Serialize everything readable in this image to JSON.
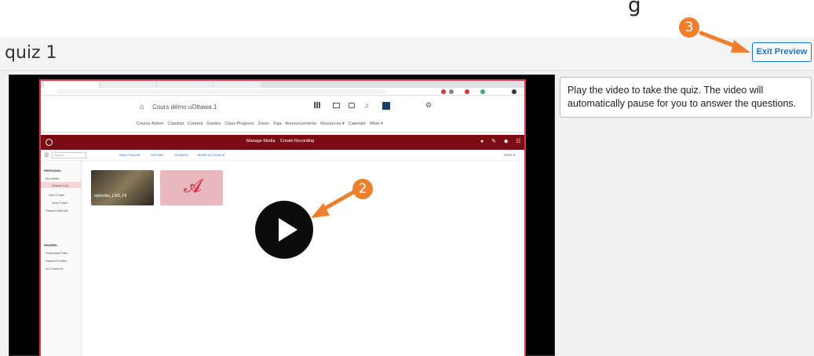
{
  "header": {
    "title": "quiz 1",
    "top_partial_text": "g"
  },
  "actions": {
    "exit_preview_label": "Exit Preview"
  },
  "instructions": {
    "text": "Play the video to take the quiz. The video will automatically pause for you to answer the questions."
  },
  "annotations": {
    "step2_label": "2",
    "step3_label": "3",
    "accent_color": "#ee7f2d"
  },
  "video_screen": {
    "course_title": "Cours démo uOttawa 1",
    "nav_items": [
      "Course Admin",
      "Classlist",
      "Content",
      "Grades",
      "Class Progress",
      "Zoom",
      "Yuja",
      "Announcements",
      "Resources ▾",
      "Calendar",
      "More ▾"
    ],
    "yuja_center_buttons": [
      "Manage Media",
      "Create Recording"
    ],
    "toolbar_items": [
      "NEW FOLDER",
      "UPLOAD",
      "GO BACK",
      "MORE ACTIONS ▾"
    ],
    "search_placeholder": "Search",
    "sort_label": "SORT ▾",
    "sidebar_personal_header": "PERSONAL",
    "sidebar_personal_items": [
      "My Media",
      "Default Coll...",
      "New Folder",
      "New Folder",
      "Shared With Me"
    ],
    "sidebar_shared_header": "SHARED",
    "sidebar_shared_items": [
      "Enterprise/Tube",
      "Shared Folders",
      "All Channels"
    ],
    "thumb1_label": "episodes_LMS_Fil",
    "brand_color": "#7a0c14"
  },
  "video_player": {
    "play_icon": "play-icon"
  }
}
